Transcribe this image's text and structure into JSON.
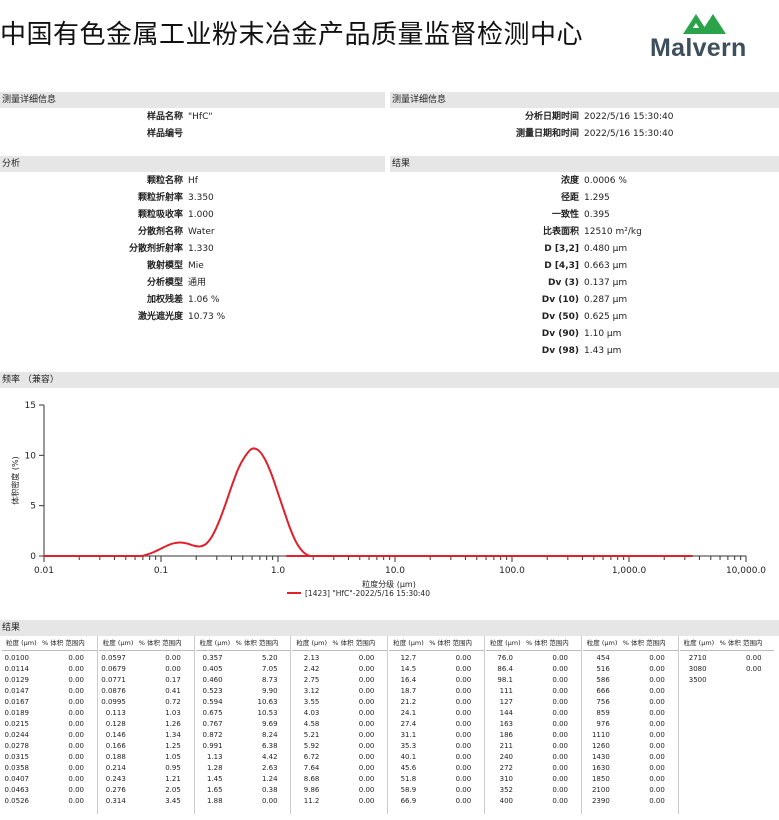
{
  "header": {
    "title": "中国有色金属工业粉末冶金产品质量监督检测中心",
    "logo_text": "Malvern"
  },
  "measurement_left": {
    "heading": "测量详细信息",
    "fields": [
      {
        "label": "样品名称",
        "value": "\"HfC\""
      },
      {
        "label": "样品编号",
        "value": ""
      }
    ]
  },
  "measurement_right": {
    "heading": "测量详细信息",
    "fields": [
      {
        "label": "分析日期时间",
        "value": "2022/5/16 15:30:40"
      },
      {
        "label": "测量日期和时间",
        "value": "2022/5/16 15:30:40"
      }
    ]
  },
  "analysis": {
    "heading": "分析",
    "fields": [
      {
        "label": "颗粒名称",
        "value": "Hf"
      },
      {
        "label": "颗粒折射率",
        "value": "3.350"
      },
      {
        "label": "颗粒吸收率",
        "value": "1.000"
      },
      {
        "label": "分散剂名称",
        "value": "Water"
      },
      {
        "label": "分散剂折射率",
        "value": "1.330"
      },
      {
        "label": "散射模型",
        "value": "Mie"
      },
      {
        "label": "分析模型",
        "value": "通用"
      },
      {
        "label": "加权残差",
        "value": "1.06 %"
      },
      {
        "label": "激光遮光度",
        "value": "10.73 %"
      }
    ]
  },
  "results": {
    "heading": "结果",
    "fields": [
      {
        "label": "浓度",
        "value": "0.0006 %"
      },
      {
        "label": "径距",
        "value": "1.295"
      },
      {
        "label": "一致性",
        "value": "0.395"
      },
      {
        "label": "比表面积",
        "value": "12510 m²/kg"
      },
      {
        "label": "D [3,2]",
        "value": "0.480 µm"
      },
      {
        "label": "D [4,3]",
        "value": "0.663 µm"
      },
      {
        "label": "Dv (3)",
        "value": "0.137 µm"
      },
      {
        "label": "Dv (10)",
        "value": "0.287 µm"
      },
      {
        "label": "Dv (50)",
        "value": "0.625 µm"
      },
      {
        "label": "Dv (90)",
        "value": "1.10 µm"
      },
      {
        "label": "Dv (98)",
        "value": "1.43 µm"
      }
    ]
  },
  "chart_section": {
    "heading": "频率 （兼容）"
  },
  "chart_data": {
    "type": "line",
    "title": "",
    "xlabel": "粒度分级 (µm)",
    "ylabel": "体积密度 (%)",
    "x_scale": "log",
    "xlim": [
      0.01,
      10000
    ],
    "ylim": [
      0,
      15
    ],
    "x_ticks": [
      0.01,
      0.1,
      1.0,
      10.0,
      100.0,
      1000.0,
      10000.0
    ],
    "x_tick_labels": [
      "0.01",
      "0.1",
      "1.0",
      "10.0",
      "100.0",
      "1,000.0",
      "10,000.0"
    ],
    "y_ticks": [
      0,
      5,
      10,
      15
    ],
    "y_tick_labels": [
      "0",
      "5",
      "10",
      "15"
    ],
    "series": [
      {
        "name": "[1423] \"HfC\"-2022/5/16 15:30:40",
        "color": "#e0202a",
        "x": [
          0.01,
          0.0597,
          0.0679,
          0.0771,
          0.0876,
          0.0995,
          0.113,
          0.128,
          0.146,
          0.166,
          0.188,
          0.214,
          0.243,
          0.276,
          0.314,
          0.357,
          0.405,
          0.46,
          0.523,
          0.594,
          0.675,
          0.767,
          0.872,
          0.991,
          1.13,
          1.28,
          1.45,
          1.65,
          1.88,
          2.13,
          3500
        ],
        "y": [
          0.0,
          0.0,
          0.0,
          0.17,
          0.41,
          0.72,
          1.03,
          1.26,
          1.34,
          1.25,
          1.05,
          0.95,
          1.21,
          2.05,
          3.45,
          5.2,
          7.05,
          8.73,
          9.9,
          10.63,
          10.53,
          9.69,
          8.24,
          6.38,
          4.42,
          2.63,
          1.24,
          0.38,
          0.0,
          0.0,
          0.0
        ]
      }
    ],
    "legend_position": "bottom-center"
  },
  "table_section": {
    "heading": "结果",
    "col_headers": [
      "粒度 (µm)",
      "% 体积 范围内"
    ],
    "groups": [
      [
        [
          "0.0100",
          "0.00"
        ],
        [
          "0.0114",
          "0.00"
        ],
        [
          "0.0129",
          "0.00"
        ],
        [
          "0.0147",
          "0.00"
        ],
        [
          "0.0167",
          "0.00"
        ],
        [
          "0.0189",
          "0.00"
        ],
        [
          "0.0215",
          "0.00"
        ],
        [
          "0.0244",
          "0.00"
        ],
        [
          "0.0278",
          "0.00"
        ],
        [
          "0.0315",
          "0.00"
        ],
        [
          "0.0358",
          "0.00"
        ],
        [
          "0.0407",
          "0.00"
        ],
        [
          "0.0463",
          "0.00"
        ],
        [
          "0.0526",
          "0.00"
        ]
      ],
      [
        [
          "0.0597",
          "0.00"
        ],
        [
          "0.0679",
          "0.00"
        ],
        [
          "0.0771",
          "0.17"
        ],
        [
          "0.0876",
          "0.41"
        ],
        [
          "0.0995",
          "0.72"
        ],
        [
          "0.113",
          "1.03"
        ],
        [
          "0.128",
          "1.26"
        ],
        [
          "0.146",
          "1.34"
        ],
        [
          "0.166",
          "1.25"
        ],
        [
          "0.188",
          "1.05"
        ],
        [
          "0.214",
          "0.95"
        ],
        [
          "0.243",
          "1.21"
        ],
        [
          "0.276",
          "2.05"
        ],
        [
          "0.314",
          "3.45"
        ]
      ],
      [
        [
          "0.357",
          "5.20"
        ],
        [
          "0.405",
          "7.05"
        ],
        [
          "0.460",
          "8.73"
        ],
        [
          "0.523",
          "9.90"
        ],
        [
          "0.594",
          "10.63"
        ],
        [
          "0.675",
          "10.53"
        ],
        [
          "0.767",
          "9.69"
        ],
        [
          "0.872",
          "8.24"
        ],
        [
          "0.991",
          "6.38"
        ],
        [
          "1.13",
          "4.42"
        ],
        [
          "1.28",
          "2.63"
        ],
        [
          "1.45",
          "1.24"
        ],
        [
          "1.65",
          "0.38"
        ],
        [
          "1.88",
          "0.00"
        ]
      ],
      [
        [
          "2.13",
          "0.00"
        ],
        [
          "2.42",
          "0.00"
        ],
        [
          "2.75",
          "0.00"
        ],
        [
          "3.12",
          "0.00"
        ],
        [
          "3.55",
          "0.00"
        ],
        [
          "4.03",
          "0.00"
        ],
        [
          "4.58",
          "0.00"
        ],
        [
          "5.21",
          "0.00"
        ],
        [
          "5.92",
          "0.00"
        ],
        [
          "6.72",
          "0.00"
        ],
        [
          "7.64",
          "0.00"
        ],
        [
          "8.68",
          "0.00"
        ],
        [
          "9.86",
          "0.00"
        ],
        [
          "11.2",
          "0.00"
        ]
      ],
      [
        [
          "12.7",
          "0.00"
        ],
        [
          "14.5",
          "0.00"
        ],
        [
          "16.4",
          "0.00"
        ],
        [
          "18.7",
          "0.00"
        ],
        [
          "21.2",
          "0.00"
        ],
        [
          "24.1",
          "0.00"
        ],
        [
          "27.4",
          "0.00"
        ],
        [
          "31.1",
          "0.00"
        ],
        [
          "35.3",
          "0.00"
        ],
        [
          "40.1",
          "0.00"
        ],
        [
          "45.6",
          "0.00"
        ],
        [
          "51.8",
          "0.00"
        ],
        [
          "58.9",
          "0.00"
        ],
        [
          "66.9",
          "0.00"
        ]
      ],
      [
        [
          "76.0",
          "0.00"
        ],
        [
          "86.4",
          "0.00"
        ],
        [
          "98.1",
          "0.00"
        ],
        [
          "111",
          "0.00"
        ],
        [
          "127",
          "0.00"
        ],
        [
          "144",
          "0.00"
        ],
        [
          "163",
          "0.00"
        ],
        [
          "186",
          "0.00"
        ],
        [
          "211",
          "0.00"
        ],
        [
          "240",
          "0.00"
        ],
        [
          "272",
          "0.00"
        ],
        [
          "310",
          "0.00"
        ],
        [
          "352",
          "0.00"
        ],
        [
          "400",
          "0.00"
        ]
      ],
      [
        [
          "454",
          "0.00"
        ],
        [
          "516",
          "0.00"
        ],
        [
          "586",
          "0.00"
        ],
        [
          "666",
          "0.00"
        ],
        [
          "756",
          "0.00"
        ],
        [
          "859",
          "0.00"
        ],
        [
          "976",
          "0.00"
        ],
        [
          "1110",
          "0.00"
        ],
        [
          "1260",
          "0.00"
        ],
        [
          "1430",
          "0.00"
        ],
        [
          "1630",
          "0.00"
        ],
        [
          "1850",
          "0.00"
        ],
        [
          "2100",
          "0.00"
        ],
        [
          "2390",
          "0.00"
        ]
      ],
      [
        [
          "2710",
          "0.00"
        ],
        [
          "3080",
          "0.00"
        ],
        [
          "3500",
          ""
        ]
      ]
    ]
  }
}
